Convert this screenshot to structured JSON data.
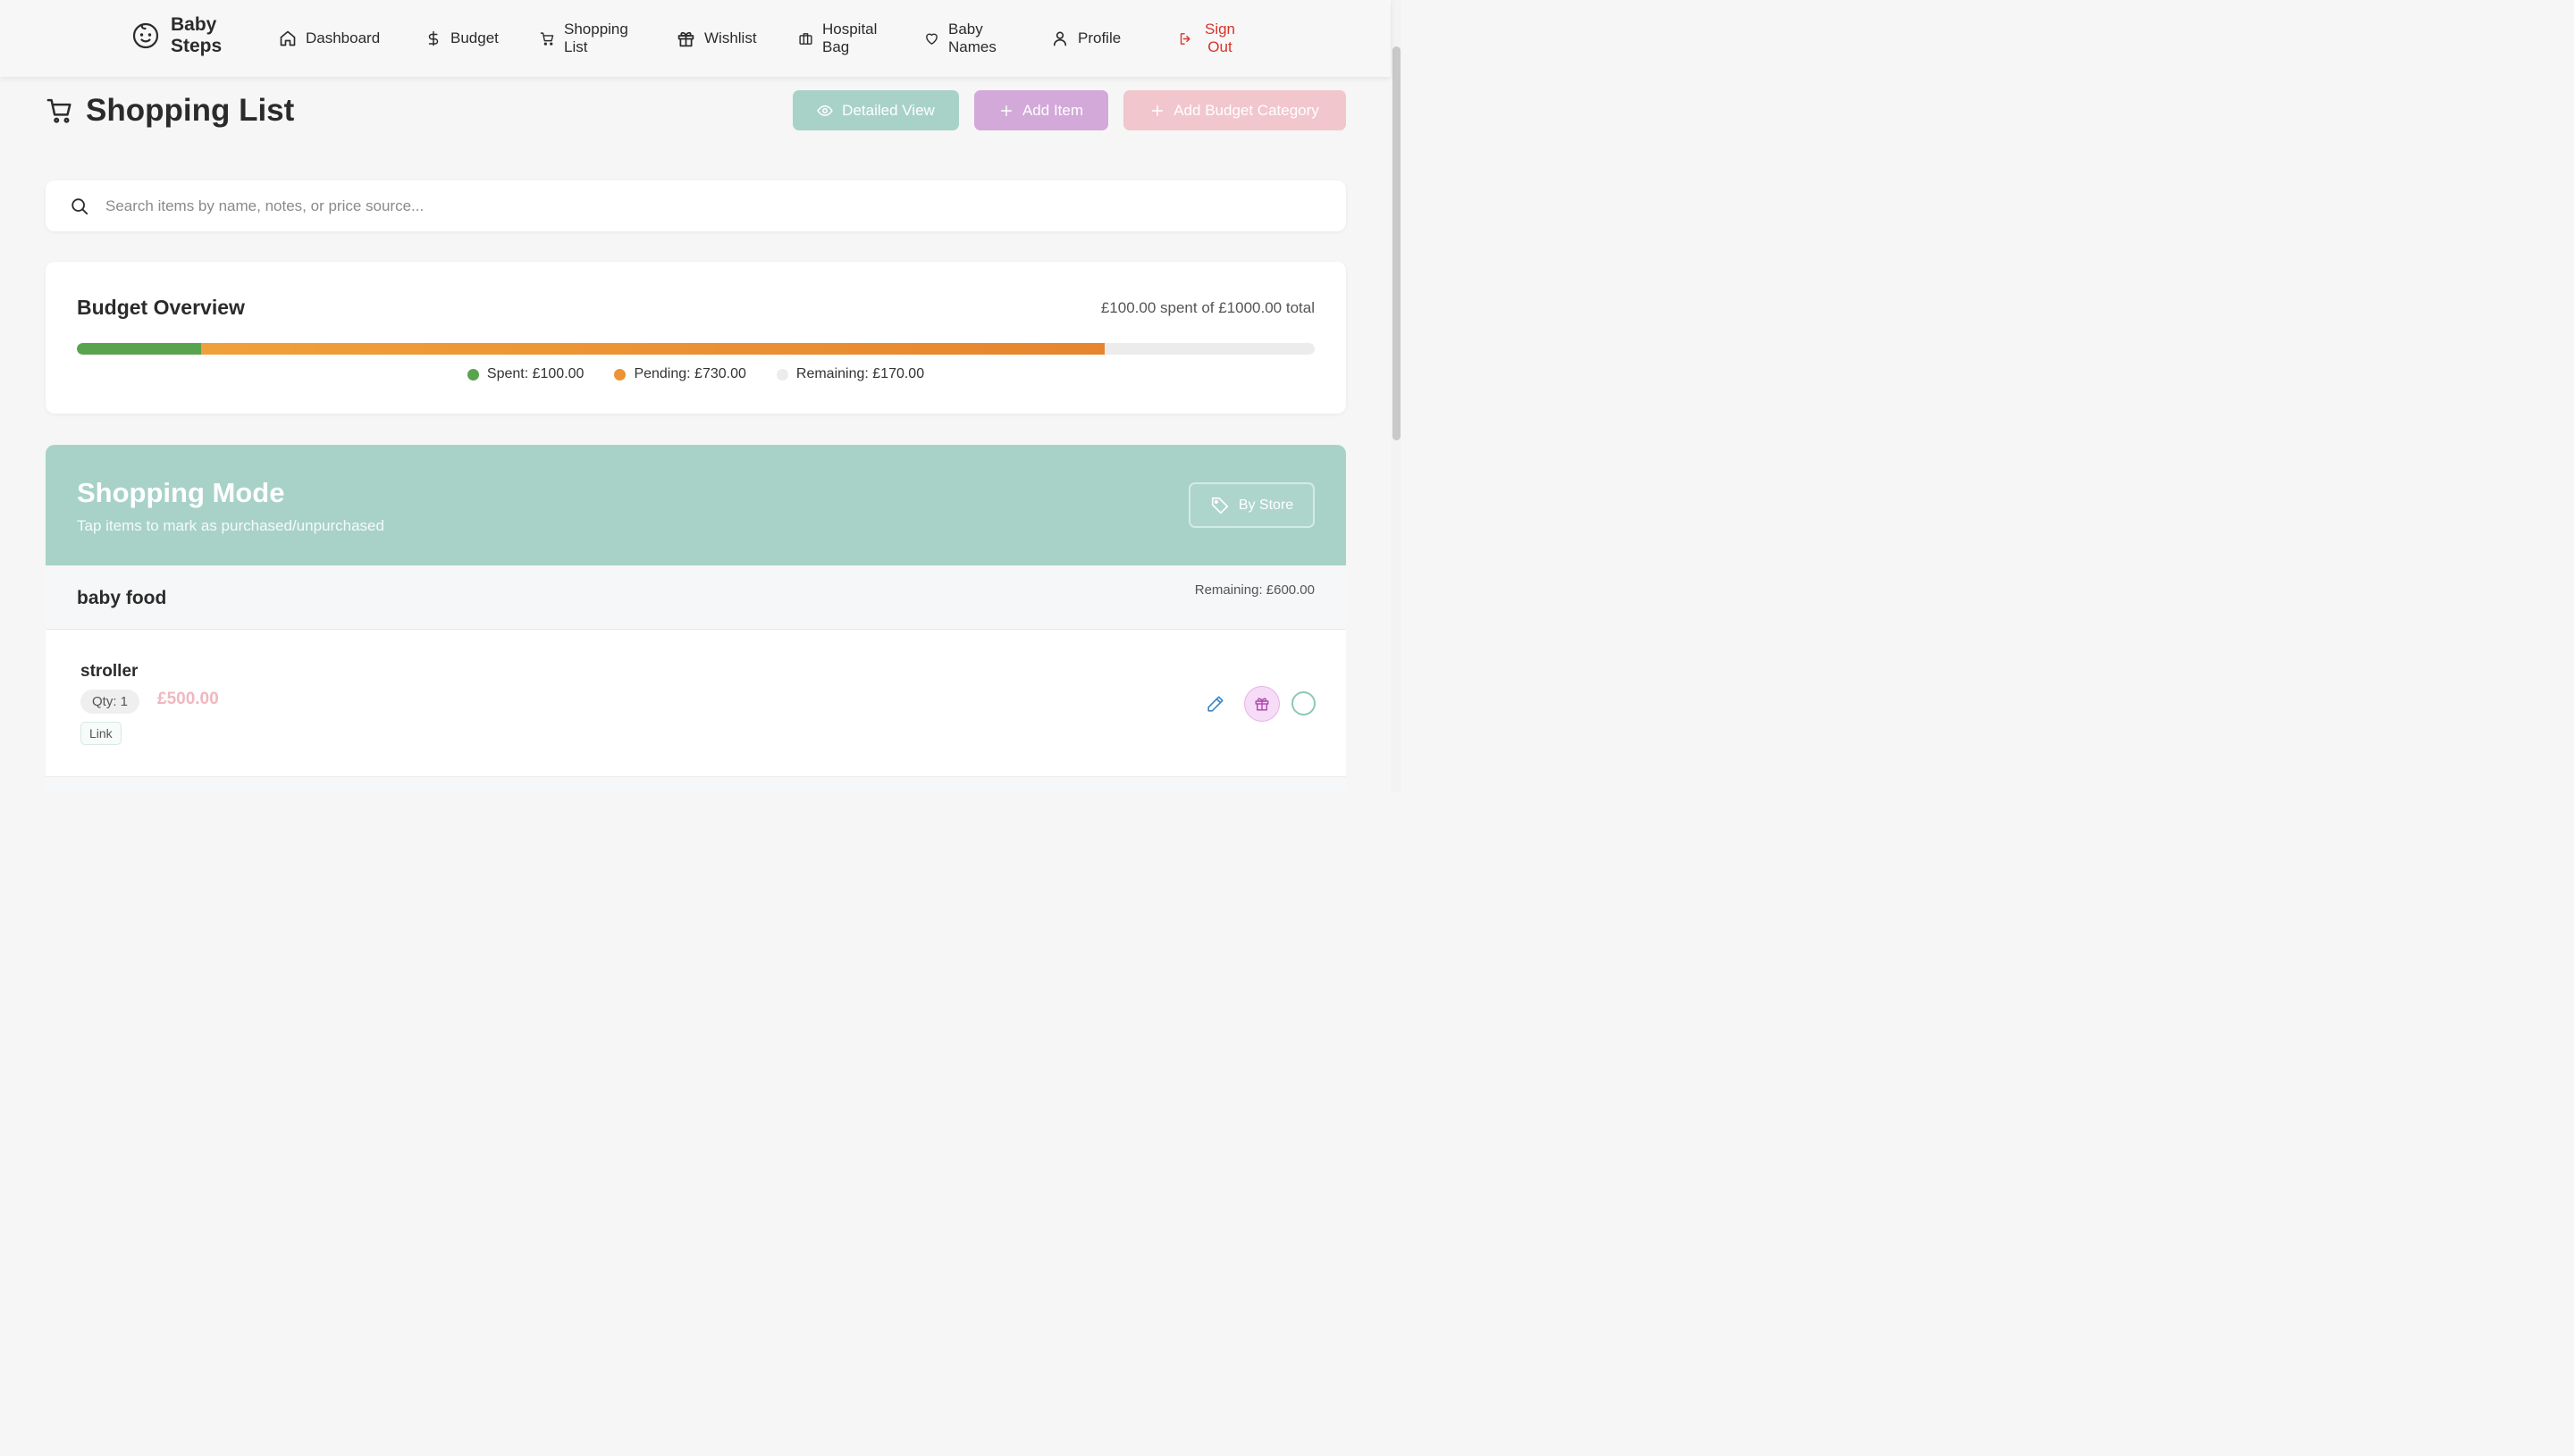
{
  "brand": {
    "name": "Baby Steps",
    "icon": "baby-face-icon"
  },
  "nav": {
    "items": [
      {
        "label": "Dashboard",
        "icon": "home-icon"
      },
      {
        "label": "Budget",
        "icon": "dollar-icon"
      },
      {
        "label": "Shopping List",
        "icon": "cart-icon"
      },
      {
        "label": "Wishlist",
        "icon": "gift-icon"
      },
      {
        "label": "Hospital Bag",
        "icon": "briefcase-icon"
      },
      {
        "label": "Baby Names",
        "icon": "heart-icon"
      },
      {
        "label": "Profile",
        "icon": "user-icon"
      },
      {
        "label": "Sign Out",
        "icon": "sign-out-icon",
        "color": "#d9342b"
      }
    ]
  },
  "page": {
    "title": "Shopping List",
    "buttons": {
      "detailed_view": "Detailed View",
      "add_item": "Add Item",
      "add_budget_category": "Add Budget Category"
    }
  },
  "search": {
    "placeholder": "Search items by name, notes, or price source..."
  },
  "overview": {
    "title": "Budget Overview",
    "summary": "£100.00 spent of £1000.00 total",
    "spent": 100,
    "pending": 730,
    "remaining": 170,
    "total": 1000,
    "legend": {
      "spent": "Spent: £100.00",
      "pending": "Pending: £730.00",
      "remaining": "Remaining: £170.00"
    },
    "colors": {
      "spent": "#5aa34e",
      "pending": "#ec9333",
      "remaining": "#ececec"
    }
  },
  "mode": {
    "title": "Shopping Mode",
    "subtitle": "Tap items to mark as purchased/unpurchased",
    "by_store": "By Store"
  },
  "category": {
    "name": "baby food",
    "remaining": "Remaining: £600.00",
    "items": [
      {
        "name": "stroller",
        "qty": "Qty: 1",
        "price": "£500.00",
        "link": "Link"
      }
    ]
  }
}
